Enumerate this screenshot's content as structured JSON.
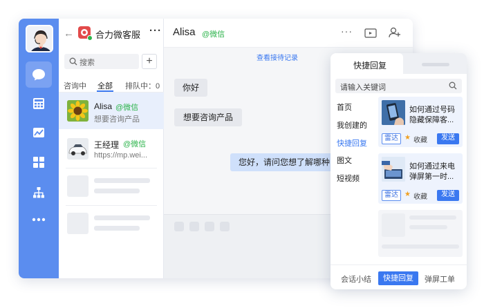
{
  "sidebar": {
    "items": [
      {
        "icon": "chat-icon",
        "active": true
      },
      {
        "icon": "calculator-icon",
        "active": false
      },
      {
        "icon": "chart-icon",
        "active": false
      },
      {
        "icon": "grid-icon",
        "active": false
      },
      {
        "icon": "org-chart-icon",
        "active": false
      },
      {
        "icon": "more-icon",
        "active": false
      }
    ]
  },
  "contacts": {
    "title": "合力微客服",
    "search_placeholder": "搜索",
    "tabs": [
      {
        "label": "咨询中"
      },
      {
        "label": "全部",
        "active": true
      },
      {
        "label": "排队中：0"
      }
    ],
    "list": [
      {
        "name": "Alisa",
        "channel": "@微信",
        "preview": "想要咨询产品"
      },
      {
        "name": "王经理",
        "channel": "@微信",
        "preview": "https://mp.wei..."
      }
    ]
  },
  "chat": {
    "name": "Alisa",
    "channel": "@微信",
    "history_link": "查看接待记录",
    "messages": [
      {
        "from": "customer",
        "text": "你好"
      },
      {
        "from": "customer",
        "text": "想要咨询产品"
      },
      {
        "from": "agent",
        "text": "您好，请问您想了解哪种"
      }
    ]
  },
  "quick_reply": {
    "tabs": [
      {
        "label": "快捷回复",
        "active": true
      }
    ],
    "search_placeholder": "请输入关键词",
    "categories": [
      {
        "label": "首页"
      },
      {
        "label": "我创建的"
      },
      {
        "label": "快捷回复",
        "active": true
      },
      {
        "label": "图文"
      },
      {
        "label": "短视频"
      }
    ],
    "cards": [
      {
        "title_line1": "如何通过号码",
        "title_line2": "隐藏保障客...",
        "tag": "雷达",
        "fav": "收藏",
        "send": "发送"
      },
      {
        "title_line1": "如何通过来电",
        "title_line2": "弹屏第一时...",
        "tag": "雷达",
        "fav": "收藏",
        "send": "发送"
      }
    ],
    "bottom_tabs": [
      {
        "label": "会话小结"
      },
      {
        "label": "快捷回复",
        "active": true
      },
      {
        "label": "弹屏工单"
      }
    ]
  },
  "colors": {
    "accent": "#3a78f0",
    "rail": "#5b8def",
    "wechat_green": "#2bb34a"
  }
}
